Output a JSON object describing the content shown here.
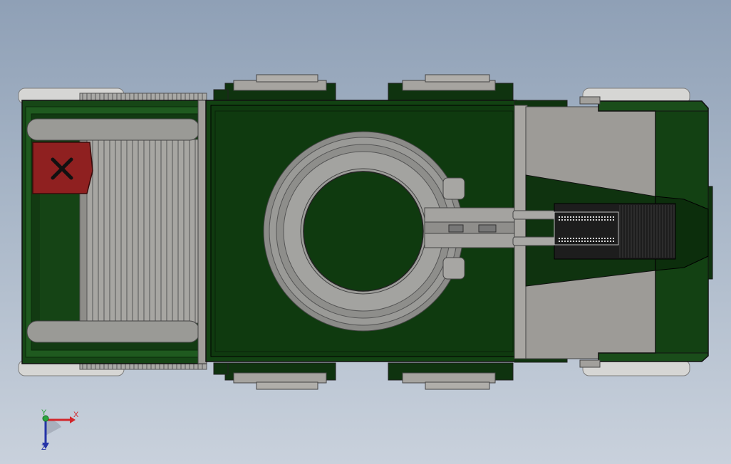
{
  "viewport": {
    "background_top": "#8fa0b6",
    "background_bottom": "#c9d1dc"
  },
  "model": {
    "body_color": "#123a12",
    "body_dark": "#0d2b0d",
    "metal_color": "#9c9a95",
    "tire_color": "#d4d4d2",
    "tank_color": "#8f2020",
    "tank_icon": "x-mark-icon",
    "grille_color": "#1d1d1d"
  },
  "triad": {
    "x_label": "X",
    "y_label": "Y",
    "z_label": "Z",
    "x_color": "#d2262a",
    "y_color": "#2aa640",
    "z_color": "#2433a8"
  }
}
